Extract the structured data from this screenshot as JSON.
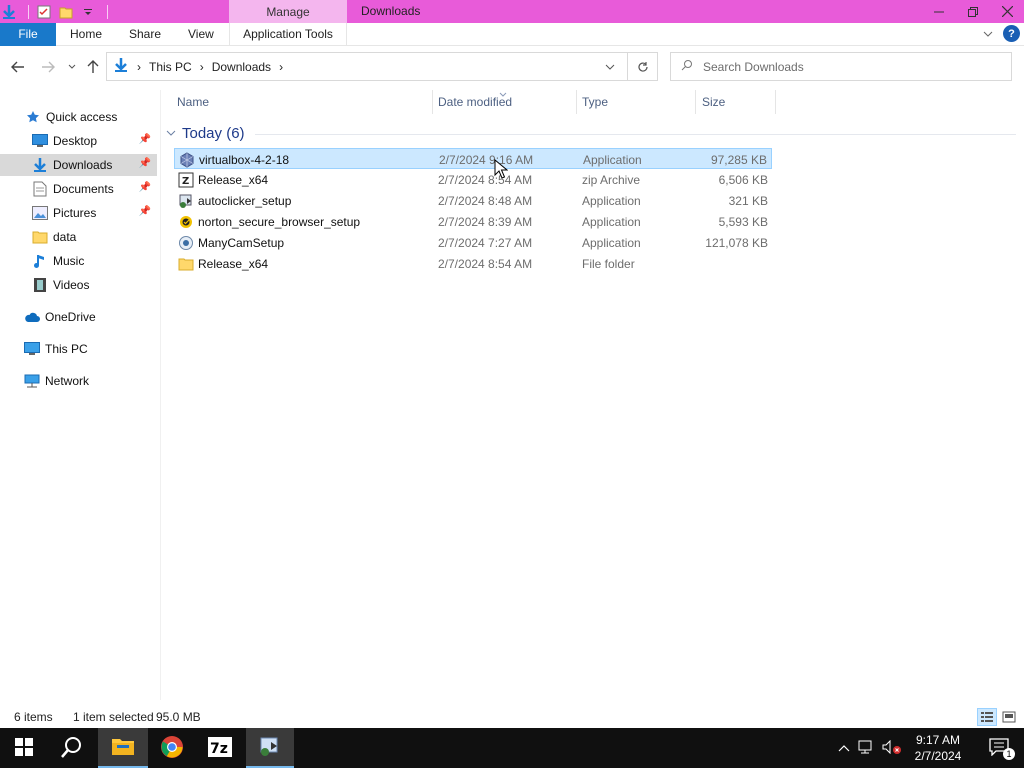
{
  "window": {
    "title": "Downloads",
    "context_tab": "Manage"
  },
  "ribbon": {
    "tabs": [
      "File",
      "Home",
      "Share",
      "View",
      "Application Tools"
    ]
  },
  "address": {
    "crumbs": [
      "This PC",
      "Downloads"
    ]
  },
  "search": {
    "placeholder": "Search Downloads"
  },
  "sidebar": {
    "items": [
      {
        "label": "Quick access",
        "icon": "star-icon"
      },
      {
        "label": "Desktop",
        "icon": "desktop-icon",
        "pinned": true
      },
      {
        "label": "Downloads",
        "icon": "download-arrow-icon",
        "pinned": true,
        "selected": true
      },
      {
        "label": "Documents",
        "icon": "document-icon",
        "pinned": true
      },
      {
        "label": "Pictures",
        "icon": "picture-icon",
        "pinned": true
      },
      {
        "label": "data",
        "icon": "folder-icon"
      },
      {
        "label": "Music",
        "icon": "music-note-icon"
      },
      {
        "label": "Videos",
        "icon": "film-icon"
      },
      {
        "label": "OneDrive",
        "icon": "cloud-icon"
      },
      {
        "label": "This PC",
        "icon": "computer-icon"
      },
      {
        "label": "Network",
        "icon": "network-icon"
      }
    ]
  },
  "columns": {
    "name": "Name",
    "date": "Date modified",
    "type": "Type",
    "size": "Size"
  },
  "group": {
    "label": "Today (6)"
  },
  "files": [
    {
      "name": "virtualbox-4-2-18",
      "date": "2/7/2024 9:16 AM",
      "type": "Application",
      "size": "97,285 KB",
      "icon": "virtualbox-icon",
      "selected": true
    },
    {
      "name": "Release_x64",
      "date": "2/7/2024 8:54 AM",
      "type": "zip Archive",
      "size": "6,506 KB",
      "icon": "zip-archive-icon"
    },
    {
      "name": "autoclicker_setup",
      "date": "2/7/2024 8:48 AM",
      "type": "Application",
      "size": "321 KB",
      "icon": "installer-icon"
    },
    {
      "name": "norton_secure_browser_setup",
      "date": "2/7/2024 8:39 AM",
      "type": "Application",
      "size": "5,593 KB",
      "icon": "norton-icon"
    },
    {
      "name": "ManyCamSetup",
      "date": "2/7/2024 7:27 AM",
      "type": "Application",
      "size": "121,078 KB",
      "icon": "manycam-icon"
    },
    {
      "name": "Release_x64",
      "date": "2/7/2024 8:54 AM",
      "type": "File folder",
      "size": "",
      "icon": "folder-icon"
    }
  ],
  "status": {
    "count": "6 items",
    "selection": "1 item selected",
    "selection_size": "95.0 MB"
  },
  "taskbar": {
    "time": "9:17 AM",
    "date": "2/7/2024",
    "notification_count": "1"
  },
  "colors": {
    "titlebar": "#e85bd9",
    "accent": "#1979ca",
    "selection": "#cce8ff"
  }
}
